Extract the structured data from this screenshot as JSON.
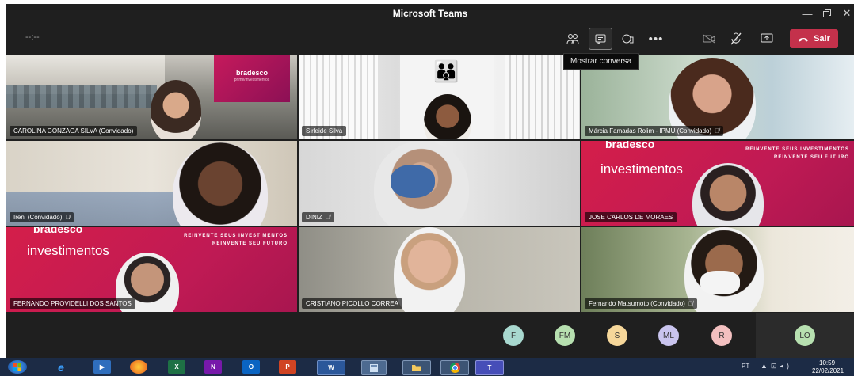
{
  "window": {
    "title": "Microsoft Teams"
  },
  "toolbar": {
    "timer": "--:--",
    "tooltip": "Mostrar conversa",
    "leave_label": "Sair"
  },
  "tiles": [
    {
      "name": "CAROLINA GONZAGA SILVA (Convidado)",
      "mic_muted": false,
      "brand": "bradesco",
      "brand_sub": "prime/investimentos"
    },
    {
      "name": "Sirleide Silva",
      "mic_muted": false
    },
    {
      "name": "Márcia Famadas Rolim - IPMU (Convidado)",
      "mic_muted": true
    },
    {
      "name": "Ireni (Convidado)",
      "mic_muted": true
    },
    {
      "name": "DINIZ",
      "mic_muted": true
    },
    {
      "name": "JOSE CARLOS DE MORAES",
      "mic_muted": false,
      "brand": "bradesco",
      "brand_sub": "investimentos",
      "tagline1": "REINVENTE SEUS INVESTIMENTOS",
      "tagline2": "REINVENTE SEU FUTURO"
    },
    {
      "name": "FERNANDO PROVIDELLI DOS SANTOS",
      "mic_muted": false,
      "brand": "bradesco",
      "brand_sub": "investimentos",
      "tagline1": "REINVENTE SEUS INVESTIMENTOS",
      "tagline2": "REINVENTE SEU FUTURO"
    },
    {
      "name": "CRISTIANO PICOLLO CORREA",
      "mic_muted": false
    },
    {
      "name": "Fernando Matsumoto (Convidado)",
      "mic_muted": true
    }
  ],
  "participants": [
    {
      "initials": "F",
      "color": "#a8d8cf"
    },
    {
      "initials": "FM",
      "color": "#b7e0b0"
    },
    {
      "initials": "S",
      "color": "#f6d79a"
    },
    {
      "initials": "ML",
      "color": "#c9c4ee"
    },
    {
      "initials": "R",
      "color": "#f3c0c0"
    }
  ],
  "self": {
    "initials": "LO",
    "color": "#b7e0b0"
  },
  "taskbar": {
    "apps": [
      {
        "icon": "windows-start-icon",
        "label": ""
      },
      {
        "icon": "edge-icon",
        "label": "e"
      },
      {
        "icon": "media-player-icon",
        "label": "▶"
      },
      {
        "icon": "firefox-icon",
        "label": ""
      },
      {
        "icon": "excel-icon",
        "label": "X"
      },
      {
        "icon": "onenote-icon",
        "label": "N"
      },
      {
        "icon": "outlook-icon",
        "label": "O"
      },
      {
        "icon": "powerpoint-icon",
        "label": "P"
      },
      {
        "icon": "word-icon",
        "label": "W"
      },
      {
        "icon": "calculator-icon",
        "label": ""
      },
      {
        "icon": "file-explorer-icon",
        "label": ""
      },
      {
        "icon": "chrome-icon",
        "label": ""
      },
      {
        "icon": "teams-icon",
        "label": "T"
      }
    ],
    "language": "PT",
    "time": "10:59",
    "date": "22/02/2021"
  }
}
